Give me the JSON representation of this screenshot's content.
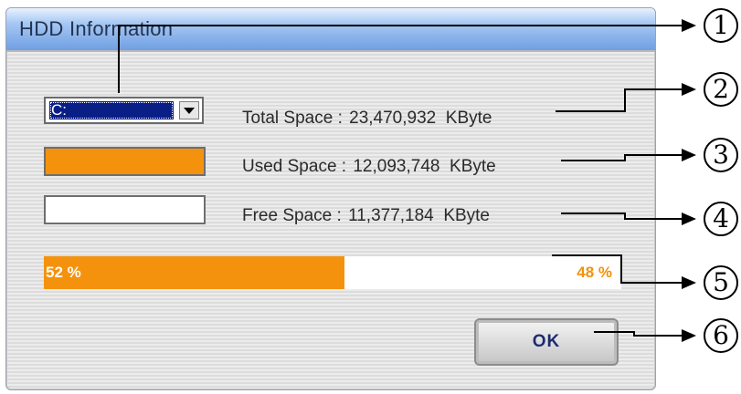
{
  "window": {
    "title": "HDD Information"
  },
  "drive": {
    "selected": "C:"
  },
  "info": {
    "total": {
      "label": "Total Space :",
      "value": "23,470,932",
      "unit": "KByte"
    },
    "used": {
      "label": "Used Space :",
      "value": "12,093,748",
      "unit": "KByte"
    },
    "free": {
      "label": "Free Space :",
      "value": "11,377,184",
      "unit": "KByte"
    }
  },
  "usage": {
    "used_percent": 52,
    "used_label": "52 %",
    "free_label": "48 %"
  },
  "buttons": {
    "ok": "OK"
  },
  "callouts": [
    "1",
    "2",
    "3",
    "4",
    "5",
    "6"
  ],
  "colors": {
    "used": "#f5920d",
    "free": "#ffffff",
    "selection": "#0a1f86"
  }
}
